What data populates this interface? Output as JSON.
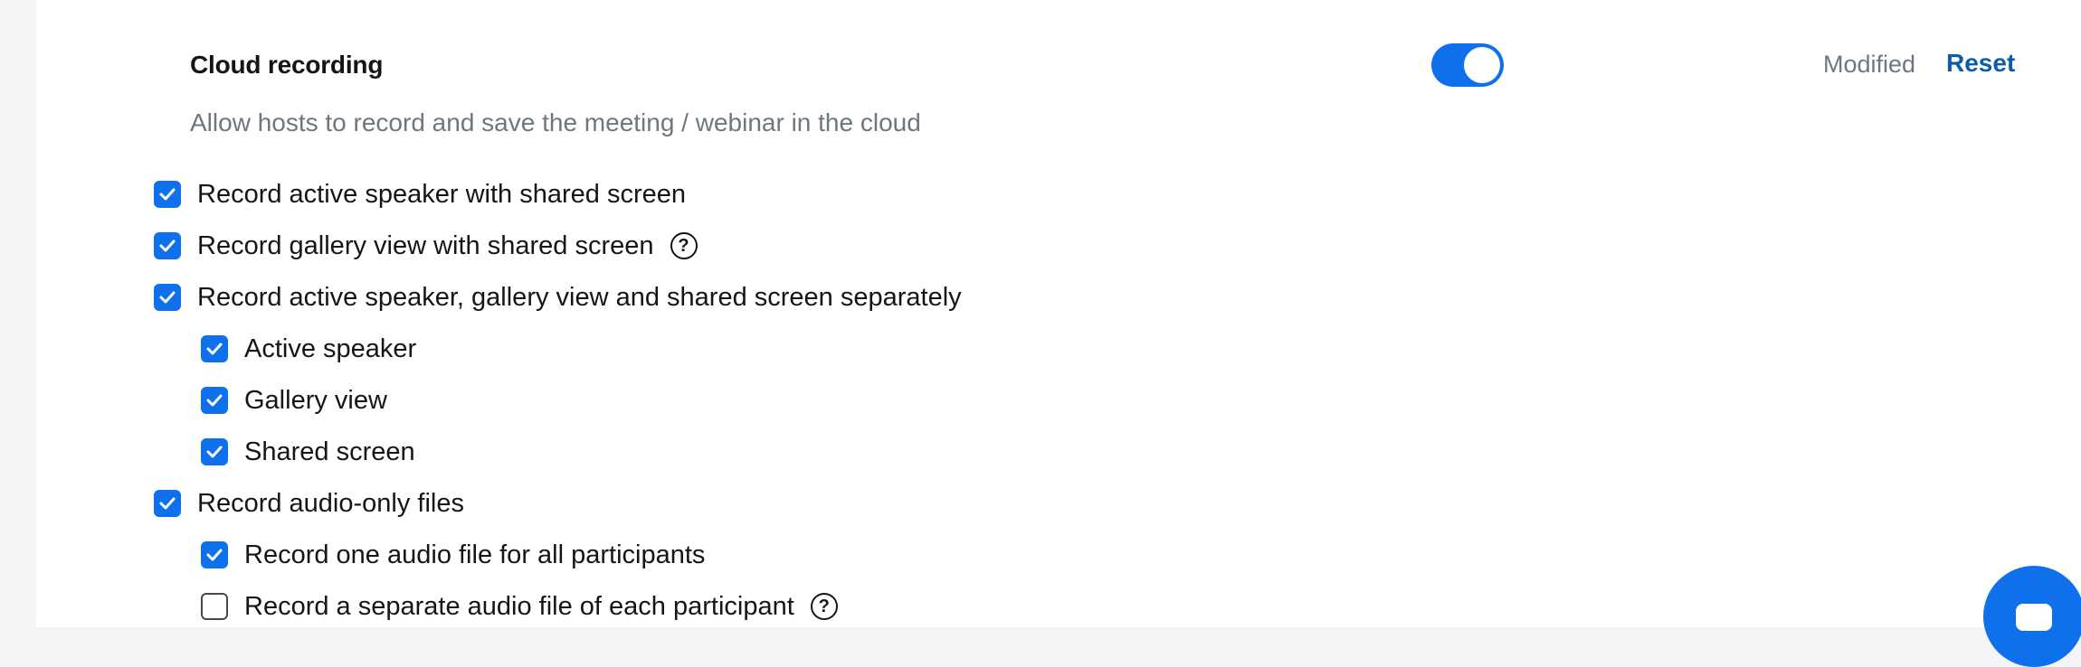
{
  "setting": {
    "title": "Cloud recording",
    "description": "Allow hosts to record and save the meeting / webinar in the cloud",
    "enabled": true,
    "status": "Modified",
    "reset_label": "Reset"
  },
  "options": [
    {
      "label": "Record active speaker with shared screen",
      "checked": true,
      "level": 0,
      "help": false
    },
    {
      "label": "Record gallery view with shared screen",
      "checked": true,
      "level": 0,
      "help": true
    },
    {
      "label": "Record active speaker, gallery view and shared screen separately",
      "checked": true,
      "level": 0,
      "help": false
    },
    {
      "label": "Active speaker",
      "checked": true,
      "level": 1,
      "help": false
    },
    {
      "label": "Gallery view",
      "checked": true,
      "level": 1,
      "help": false
    },
    {
      "label": "Shared screen",
      "checked": true,
      "level": 1,
      "help": false
    },
    {
      "label": "Record audio-only files",
      "checked": true,
      "level": 0,
      "help": false
    },
    {
      "label": "Record one audio file for all participants",
      "checked": true,
      "level": 1,
      "help": false
    },
    {
      "label": "Record a separate audio file of each participant",
      "checked": false,
      "level": 1,
      "help": true
    }
  ],
  "help_glyph": "?",
  "icons": {
    "check": "checkmark-icon",
    "help": "question-circle-icon",
    "chat": "chat-bubble-icon"
  },
  "colors": {
    "accent": "#0e71eb",
    "link": "#0b5cad",
    "muted": "#6e7680",
    "text": "#131619"
  }
}
